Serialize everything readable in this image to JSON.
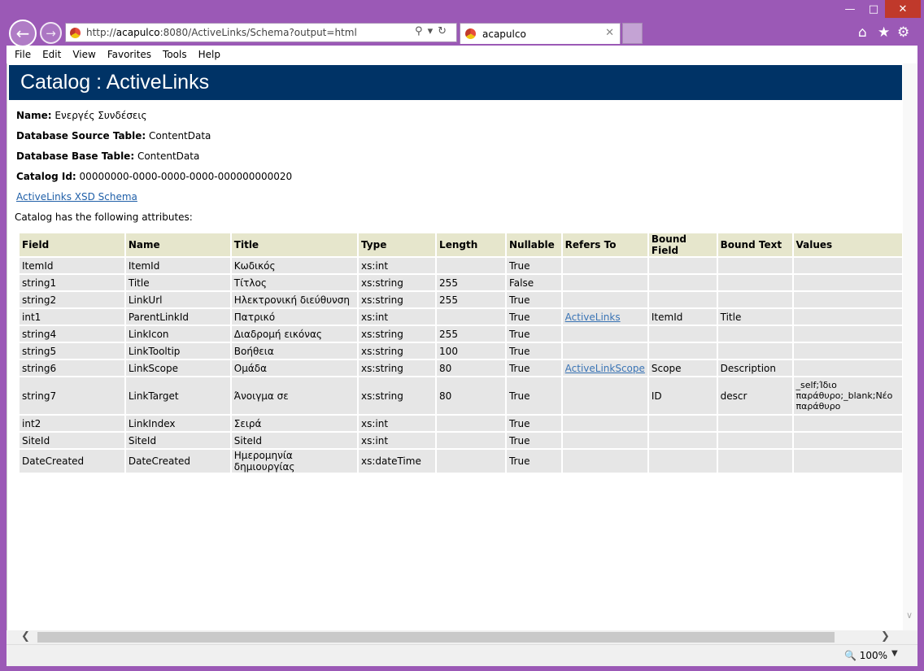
{
  "browser": {
    "address_url_prefix": "http://",
    "address_url_host": "acapulco",
    "address_url_rest": ":8080/ActiveLinks/Schema?output=html",
    "tab_title": "acapulco",
    "zoom": "100%"
  },
  "menu": [
    "File",
    "Edit",
    "View",
    "Favorites",
    "Tools",
    "Help"
  ],
  "page": {
    "heading": "Catalog : ActiveLinks",
    "name_label": "Name:",
    "name_value": "Ενεργές Συνδέσεις",
    "src_label": "Database Source Table:",
    "src_value": "ContentData",
    "base_label": "Database Base Table:",
    "base_value": "ContentData",
    "id_label": "Catalog Id:",
    "id_value": "00000000-0000-0000-0000-000000000020",
    "schema_link": "ActiveLinks XSD Schema",
    "attrs_intro": "Catalog has the following attributes:"
  },
  "table": {
    "headers": [
      "Field",
      "Name",
      "Title",
      "Type",
      "Length",
      "Nullable",
      "Refers To",
      "Bound Field",
      "Bound Text",
      "Values"
    ],
    "rows": [
      [
        "ItemId",
        "ItemId",
        "Κωδικός",
        "xs:int",
        "",
        "True",
        "",
        "",
        "",
        ""
      ],
      [
        "string1",
        "Title",
        "Τίτλος",
        "xs:string",
        "255",
        "False",
        "",
        "",
        "",
        ""
      ],
      [
        "string2",
        "LinkUrl",
        "Ηλεκτρονική διεύθυνση",
        "xs:string",
        "255",
        "True",
        "",
        "",
        "",
        ""
      ],
      [
        "int1",
        "ParentLinkId",
        "Πατρικό",
        "xs:int",
        "",
        "True",
        "ActiveLinks",
        "ItemId",
        "Title",
        ""
      ],
      [
        "string4",
        "LinkIcon",
        "Διαδρομή εικόνας",
        "xs:string",
        "255",
        "True",
        "",
        "",
        "",
        ""
      ],
      [
        "string5",
        "LinkTooltip",
        "Βοήθεια",
        "xs:string",
        "100",
        "True",
        "",
        "",
        "",
        ""
      ],
      [
        "string6",
        "LinkScope",
        "Ομάδα",
        "xs:string",
        "80",
        "True",
        "ActiveLinkScope",
        "Scope",
        "Description",
        ""
      ],
      [
        "string7",
        "LinkTarget",
        "Άνοιγμα σε",
        "xs:string",
        "80",
        "True",
        "",
        "ID",
        "descr",
        "_self;Ίδιο παράθυρο;_blank;Νέο παράθυρο"
      ],
      [
        "int2",
        "LinkIndex",
        "Σειρά",
        "xs:int",
        "",
        "True",
        "",
        "",
        "",
        ""
      ],
      [
        "SiteId",
        "SiteId",
        "SiteId",
        "xs:int",
        "",
        "True",
        "",
        "",
        "",
        ""
      ],
      [
        "DateCreated",
        "DateCreated",
        "Ημερομηνία δημιουργίας",
        "xs:dateTime",
        "",
        "True",
        "",
        "",
        "",
        ""
      ]
    ]
  },
  "colors": {
    "banner": "#003366",
    "header_cell": "#e6e6cc",
    "body_cell": "#e6e6e6",
    "link": "#3a74b5",
    "chrome": "#9b59b6"
  }
}
